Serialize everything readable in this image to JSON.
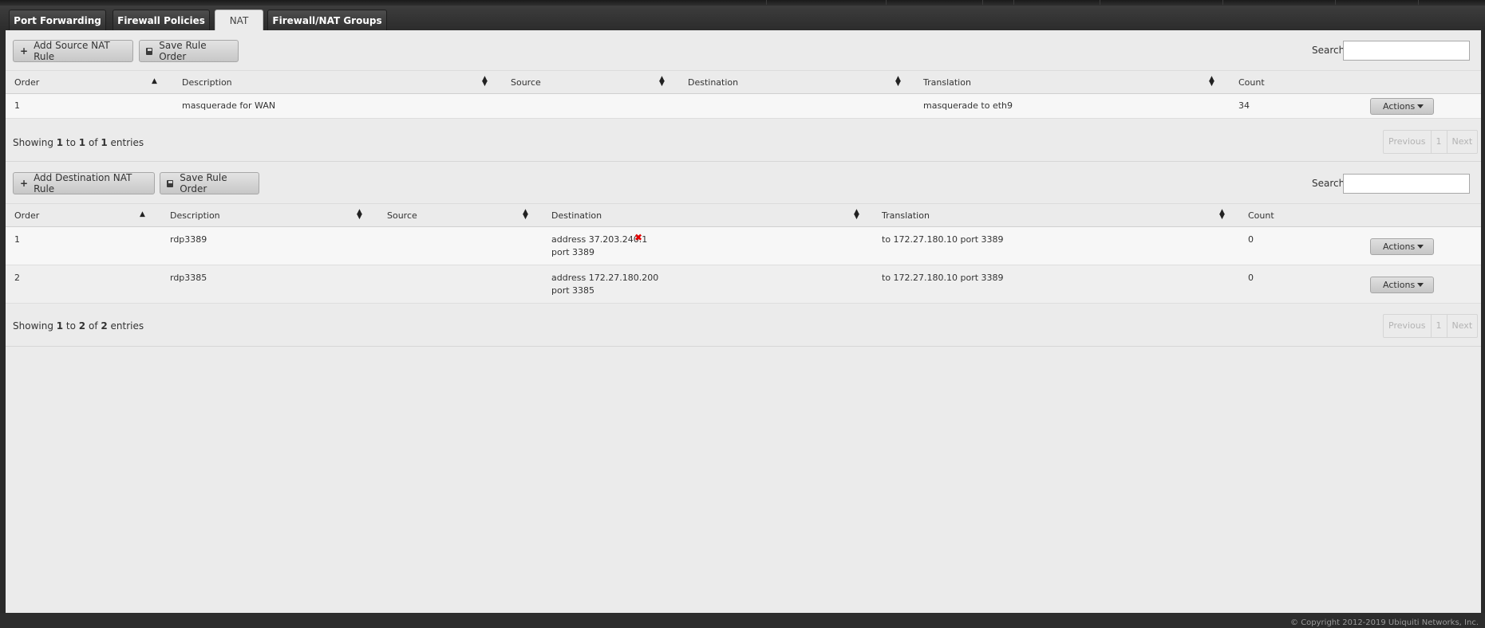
{
  "tabs": [
    {
      "label": "Port Forwarding"
    },
    {
      "label": "Firewall Policies"
    },
    {
      "label": "NAT"
    },
    {
      "label": "Firewall/NAT Groups"
    }
  ],
  "source_nat": {
    "add_button": "Add Source NAT Rule",
    "save_button": "Save Rule Order",
    "search_label": "Search",
    "search_value": "",
    "columns": [
      "Order",
      "Description",
      "Source",
      "Destination",
      "Translation",
      "Count"
    ],
    "rows": [
      {
        "order": "1",
        "description": "masquerade for WAN",
        "source": "",
        "destination": "",
        "translation": "masquerade to eth9",
        "count": "34",
        "actions": "Actions"
      }
    ],
    "showing_prefix": "Showing ",
    "showing_from": "1",
    "showing_to_word": " to ",
    "showing_to": "1",
    "showing_of_word": " of ",
    "showing_total": "1",
    "showing_suffix": " entries",
    "pager": {
      "previous": "Previous",
      "page": "1",
      "next": "Next"
    }
  },
  "destination_nat": {
    "add_button": "Add Destination NAT Rule",
    "save_button": "Save Rule Order",
    "search_label": "Search",
    "search_value": "",
    "columns": [
      "Order",
      "Description",
      "Source",
      "Destination",
      "Translation",
      "Count"
    ],
    "rows": [
      {
        "order": "1",
        "description": "rdp3389",
        "source": "",
        "destination_line1": "address 37.203.240.1",
        "destination_line2": "port 3389",
        "translation": "to 172.27.180.10 port 3389",
        "count": "0",
        "actions": "Actions"
      },
      {
        "order": "2",
        "description": "rdp3385",
        "source": "",
        "destination_line1": "address 172.27.180.200",
        "destination_line2": "port 3385",
        "translation": "to 172.27.180.10 port 3389",
        "count": "0",
        "actions": "Actions"
      }
    ],
    "showing_prefix": "Showing ",
    "showing_from": "1",
    "showing_to_word": " to ",
    "showing_to": "2",
    "showing_of_word": " of ",
    "showing_total": "2",
    "showing_suffix": " entries",
    "pager": {
      "previous": "Previous",
      "page": "1",
      "next": "Next"
    }
  },
  "footer": {
    "copyright": "© Copyright 2012-2019 Ubiquiti Networks, Inc."
  },
  "colors": {
    "panel_bg": "#ebebeb",
    "chrome_dark": "#2a2a2a",
    "redaction": "#e00000"
  }
}
